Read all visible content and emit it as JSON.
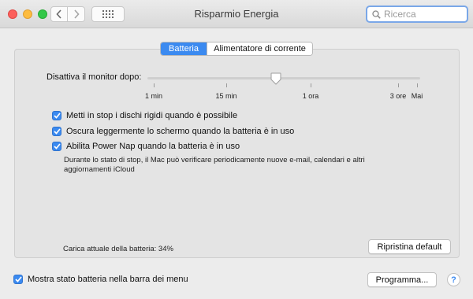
{
  "window": {
    "title": "Risparmio Energia"
  },
  "toolbar": {
    "back_icon": "chevron-left-icon",
    "forward_icon": "chevron-right-icon",
    "show_all_icon": "grid-icon"
  },
  "search": {
    "placeholder": "Ricerca",
    "value": ""
  },
  "tabs": [
    {
      "label": "Batteria",
      "active": true
    },
    {
      "label": "Alimentatore di corrente",
      "active": false
    }
  ],
  "slider": {
    "label": "Disattiva il monitor dopo:",
    "ticks": [
      "1 min",
      "15 min",
      "1 ora",
      "3 ore",
      "Mai"
    ],
    "value_fraction": 0.47
  },
  "options": [
    {
      "label": "Metti in stop i dischi rigidi quando è possibile",
      "checked": true
    },
    {
      "label": "Oscura leggermente lo schermo quando la batteria è in uso",
      "checked": true
    },
    {
      "label": "Abilita Power Nap quando la batteria è in uso",
      "checked": true
    }
  ],
  "power_nap_description": "Durante lo stato di stop, il Mac può verificare periodicamente nuove e-mail, calendari e altri aggiornamenti iCloud",
  "battery_status": "Carica attuale della batteria: 34%",
  "buttons": {
    "restore_defaults": "Ripristina default",
    "schedule": "Programma...",
    "help": "?"
  },
  "show_battery_in_menu": {
    "label": "Mostra stato batteria nella barra dei menu",
    "checked": true
  },
  "colors": {
    "accent": "#3b8af0"
  }
}
